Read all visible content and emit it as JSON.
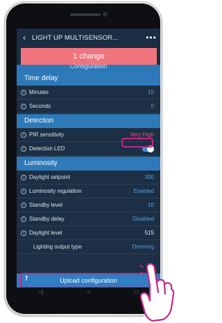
{
  "app_bar": {
    "title": "LIGHT UP MULTISENSOR...",
    "back_icon": "chevron-left-icon",
    "more_icon": "more-horizontal-icon"
  },
  "banner": {
    "text": "1 change",
    "partial_heading": "Configuration"
  },
  "sections": {
    "time_delay": {
      "title": "Time delay",
      "minutes": {
        "label": "Minutes",
        "value": "15"
      },
      "seconds": {
        "label": "Seconds",
        "value": "0"
      }
    },
    "detection": {
      "title": "Detection",
      "pir_sensitivity": {
        "label": "PIR sensitivity",
        "value": "Very High"
      },
      "detection_led": {
        "label": "Detection LED",
        "value": "on"
      }
    },
    "luminosity": {
      "title": "Luminosity",
      "daylight_setpoint": {
        "label": "Daylight setpoint",
        "value": "300"
      },
      "luminosity_regulation": {
        "label": "Luminosity regulation",
        "value": "Enabled"
      },
      "standby_level": {
        "label": "Standby level",
        "value": "10"
      },
      "standby_delay": {
        "label": "Standby delay",
        "value": "Disabled"
      },
      "daylight_level": {
        "label": "Daylight level",
        "value": "515"
      },
      "lighting_output_type": {
        "label": "Lighting output type",
        "value": "Dimming"
      }
    }
  },
  "upload_button": {
    "label": "Upload configuration",
    "icon": "upload-arrow-icon"
  },
  "nav": {
    "back": "◁",
    "home": "○",
    "recents": "□"
  },
  "colors": {
    "banner": "#f1757f",
    "section_header": "#2e79b9",
    "screen_bg": "#1c2f44",
    "value_blue": "#4fa3e6",
    "highlight": "#c5268a"
  }
}
